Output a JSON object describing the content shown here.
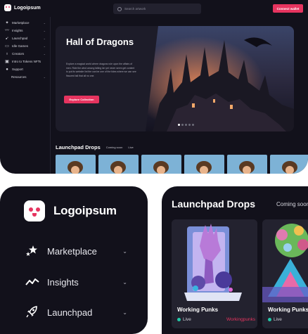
{
  "app": {
    "brand": "Logoipsum",
    "search_placeholder": "Search artwork",
    "connect_label": "Connect wallet",
    "sidebar": [
      {
        "label": "Marketplace",
        "icon": "stars-icon",
        "chevron": true
      },
      {
        "label": "Insights",
        "icon": "chart-icon",
        "chevron": true
      },
      {
        "label": "Launchpad",
        "icon": "rocket-icon",
        "chevron": true
      },
      {
        "label": "Idle Games",
        "icon": "gamepad-icon",
        "chevron": true
      },
      {
        "label": "Creators",
        "icon": "bulb-icon",
        "chevron": true
      },
      {
        "label": "Intro to Tokens NFTs",
        "icon": "info-icon",
        "chevron": false
      },
      {
        "label": "Support",
        "icon": "support-icon",
        "chevron": false
      },
      {
        "label": "Resources",
        "icon": "",
        "chevron": true
      }
    ],
    "hero": {
      "title": "Hall of Dragons",
      "description": "Explore a magical world where dragons rule upon the affairs of men. Ride the wind among falling kin yet never seem get content to put its website lint the can be one of the tides where we can see fissured tail that all no one.",
      "cta": "Explore Collection",
      "slides": 5,
      "active_slide": 0
    },
    "launchpad": {
      "title": "Launchpad Drops",
      "filters": [
        "Coming soon",
        "Live"
      ],
      "thumb_count": 6
    }
  },
  "zoom_sidebar": {
    "brand": "Logoipsum",
    "items": [
      {
        "label": "Marketplace",
        "icon": "stars-icon"
      },
      {
        "label": "Insights",
        "icon": "chart-icon"
      },
      {
        "label": "Launchpad",
        "icon": "rocket-icon"
      }
    ]
  },
  "zoom_drops": {
    "title": "Launchpad Drops",
    "filter": "Coming soon",
    "cards": [
      {
        "name": "Working Punks",
        "status": "Live",
        "creator": "Workingpunks"
      },
      {
        "name": "Working Punks",
        "status": "Live",
        "creator": ""
      }
    ]
  },
  "colors": {
    "background": "#12111b",
    "accent": "#e6345f",
    "live": "#22c8a8"
  }
}
